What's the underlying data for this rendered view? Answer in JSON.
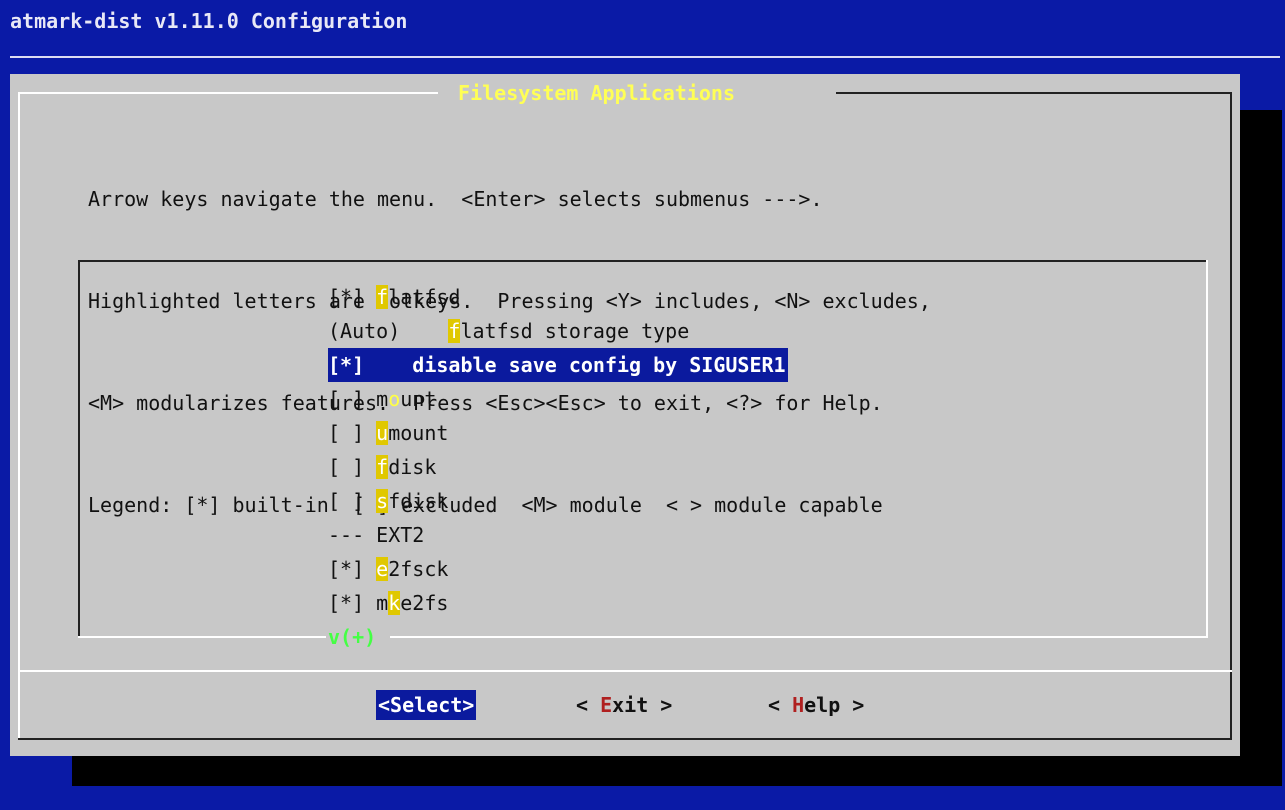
{
  "screen": {
    "title": "atmark-dist v1.11.0 Configuration"
  },
  "dialog": {
    "title": " Filesystem Applications ",
    "help_lines": [
      "Arrow keys navigate the menu.  <Enter> selects submenus --->.",
      "Highlighted letters are hotkeys.  Pressing <Y> includes, <N> excludes,",
      "<M> modularizes features.  Press <Esc><Esc> to exit, <?> for Help.",
      "Legend: [*] built-in  [ ] excluded  <M> module  < > module capable"
    ]
  },
  "menu": {
    "items": [
      {
        "prefix": "[*] ",
        "hotkey": "f",
        "rest": "latfsd",
        "selected": false
      },
      {
        "prefix": "(Auto)    ",
        "hotkey": "f",
        "rest": "latfsd storage type",
        "selected": false
      },
      {
        "prefix": "[*]    ",
        "hotkey": "",
        "rest": "disable save config by SIGUSER1",
        "selected": true
      },
      {
        "prefix": "[ ] m",
        "hotkey": "o",
        "rest": "unt",
        "selected": false
      },
      {
        "prefix": "[ ] ",
        "hotkey": "u",
        "rest": "mount",
        "selected": false
      },
      {
        "prefix": "[ ] ",
        "hotkey": "f",
        "rest": "disk",
        "selected": false
      },
      {
        "prefix": "[ ] ",
        "hotkey": "s",
        "rest": "fdisk",
        "selected": false
      },
      {
        "prefix": "--- EXT2",
        "hotkey": "",
        "rest": "",
        "selected": false
      },
      {
        "prefix": "[*] ",
        "hotkey": "e",
        "rest": "2fsck",
        "selected": false
      },
      {
        "prefix": "[*] m",
        "hotkey": "k",
        "rest": "e2fs",
        "selected": false
      }
    ],
    "more_indicator": "v(+)"
  },
  "buttons": {
    "select": {
      "label": "<Select>"
    },
    "exit": {
      "pre": "< ",
      "accel": "E",
      "post": "xit >"
    },
    "help": {
      "pre": "< ",
      "accel": "H",
      "post": "elp >"
    }
  },
  "colors": {
    "background": "#0a1aa6",
    "dialog": "#c8c8c8",
    "title": "#ffff55",
    "highlight": "#0b1a9e",
    "hotkey": "#e0c800",
    "accelerator": "#b02020",
    "more_indicator": "#44ff44"
  }
}
